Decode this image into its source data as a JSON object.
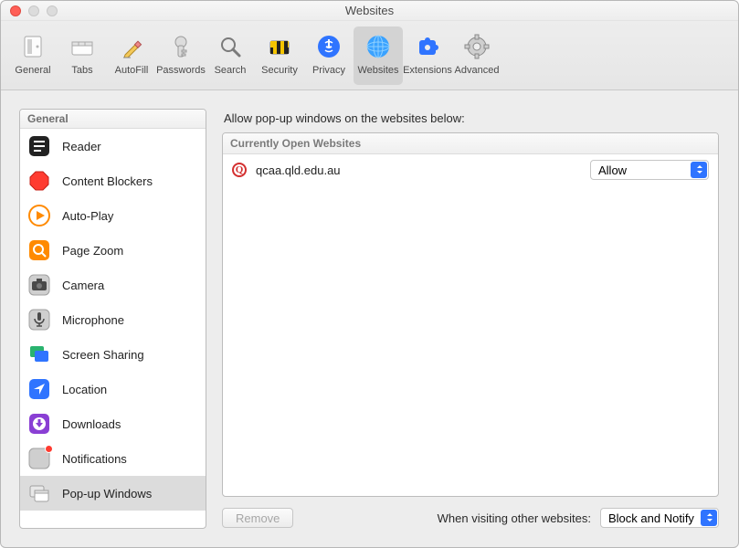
{
  "window": {
    "title": "Websites"
  },
  "toolbar": [
    {
      "id": "general",
      "label": "General",
      "icon": "general-icon"
    },
    {
      "id": "tabs",
      "label": "Tabs",
      "icon": "tabs-icon"
    },
    {
      "id": "autofill",
      "label": "AutoFill",
      "icon": "autofill-icon"
    },
    {
      "id": "passwords",
      "label": "Passwords",
      "icon": "passwords-icon"
    },
    {
      "id": "search",
      "label": "Search",
      "icon": "search-icon"
    },
    {
      "id": "security",
      "label": "Security",
      "icon": "security-icon"
    },
    {
      "id": "privacy",
      "label": "Privacy",
      "icon": "privacy-icon"
    },
    {
      "id": "websites",
      "label": "Websites",
      "icon": "websites-icon",
      "selected": true
    },
    {
      "id": "extensions",
      "label": "Extensions",
      "icon": "extensions-icon"
    },
    {
      "id": "advanced",
      "label": "Advanced",
      "icon": "advanced-icon"
    }
  ],
  "sidebar": {
    "heading": "General",
    "items": [
      {
        "label": "Reader",
        "icon": "reader-icon"
      },
      {
        "label": "Content Blockers",
        "icon": "stop-icon"
      },
      {
        "label": "Auto-Play",
        "icon": "play-icon"
      },
      {
        "label": "Page Zoom",
        "icon": "zoom-icon"
      },
      {
        "label": "Camera",
        "icon": "camera-icon"
      },
      {
        "label": "Microphone",
        "icon": "microphone-icon"
      },
      {
        "label": "Screen Sharing",
        "icon": "screens-icon"
      },
      {
        "label": "Location",
        "icon": "location-icon"
      },
      {
        "label": "Downloads",
        "icon": "downloads-icon"
      },
      {
        "label": "Notifications",
        "icon": "notifications-icon",
        "badge": true
      },
      {
        "label": "Pop-up Windows",
        "icon": "popup-icon",
        "selected": true
      }
    ]
  },
  "main": {
    "heading": "Allow pop-up windows on the websites below:",
    "section_label": "Currently Open Websites",
    "rows": [
      {
        "site": "qcaa.qld.edu.au",
        "value": "Allow"
      }
    ],
    "remove_label": "Remove",
    "footer_label": "When visiting other websites:",
    "footer_value": "Block and Notify"
  }
}
